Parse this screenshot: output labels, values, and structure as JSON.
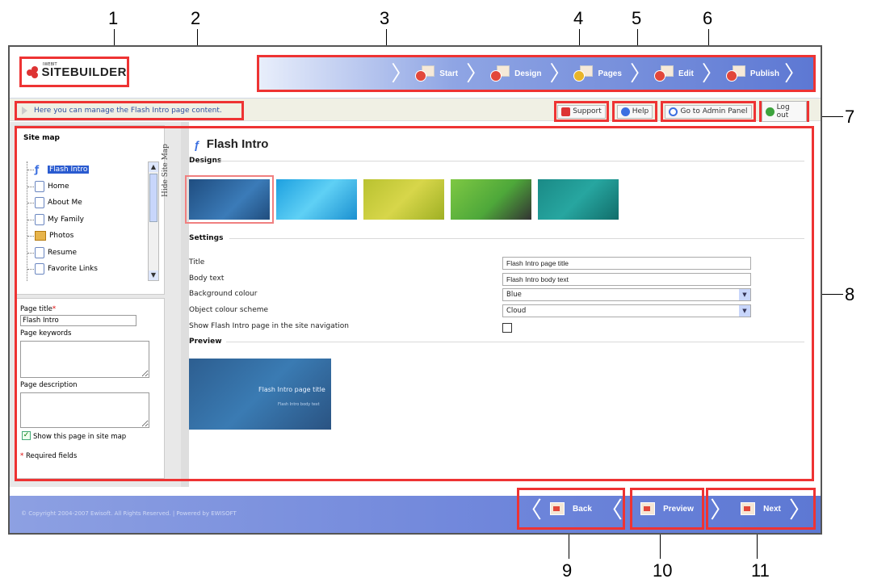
{
  "callouts": [
    "1",
    "2",
    "3",
    "4",
    "5",
    "6",
    "7",
    "8",
    "9",
    "10",
    "11"
  ],
  "app": {
    "brand": "SITEBUILDER",
    "brand_small": "IWEBIT"
  },
  "wizard": {
    "steps": [
      "Start",
      "Design",
      "Pages",
      "Edit",
      "Publish"
    ]
  },
  "infobar": {
    "hint": "Here you can manage the Flash Intro page content."
  },
  "toolbar": {
    "support": "Support",
    "help": "Help",
    "admin": "Go to Admin Panel",
    "logout": "Log out"
  },
  "sidebar": {
    "title": "Site map",
    "tree": [
      "Flash Intro",
      "Home",
      "About Me",
      "My Family",
      "Photos",
      "Resume",
      "Favorite Links"
    ],
    "hide_label": "Hide Site Map"
  },
  "page_props": {
    "page_title_label": "Page title",
    "page_title_value": "Flash Intro",
    "keywords_label": "Page keywords",
    "description_label": "Page description",
    "show_in_sitemap": "Show this page in site map",
    "required": "Required fields"
  },
  "main": {
    "title": "Flash Intro",
    "designs_label": "Designs",
    "settings_label": "Settings",
    "preview_label": "Preview",
    "settings": [
      {
        "label": "Title",
        "value": "Flash Intro page title"
      },
      {
        "label": "Body text",
        "value": "Flash Intro body text"
      },
      {
        "label": "Background colour",
        "value": "Blue"
      },
      {
        "label": "Object colour scheme",
        "value": "Cloud"
      },
      {
        "label": "Show Flash Intro page in the site navigation",
        "value": ""
      }
    ],
    "preview_title": "Flash Intro page title",
    "preview_body": "Flash Intro body text"
  },
  "footer": {
    "copyright": "© Copyright 2004-2007 Ewisoft. All Rights Reserved. | Powered by  EWISOFT"
  },
  "nav": {
    "back": "Back",
    "preview": "Preview",
    "next": "Next"
  },
  "colors": {
    "highlight": "#e33333",
    "wizard": "#5d78d3",
    "link": "#3050a0"
  }
}
